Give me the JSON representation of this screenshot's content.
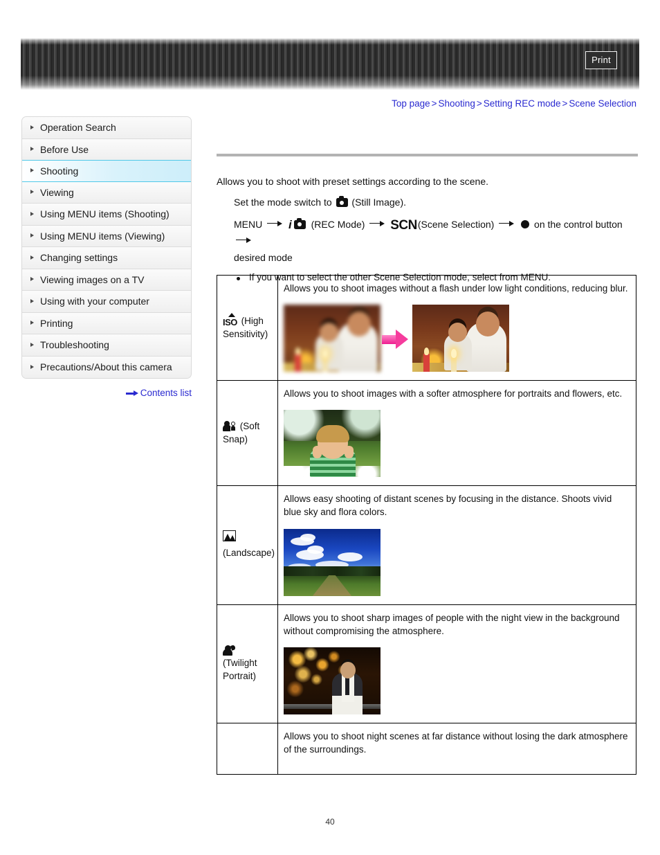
{
  "header": {
    "print_label": "Print"
  },
  "breadcrumb": {
    "items": [
      "Top page",
      "Shooting",
      "Setting REC mode",
      "Scene Selection"
    ],
    "separator": ">"
  },
  "sidebar": {
    "items": [
      {
        "label": "Operation Search",
        "active": false
      },
      {
        "label": "Before Use",
        "active": false
      },
      {
        "label": "Shooting",
        "active": true
      },
      {
        "label": "Viewing",
        "active": false
      },
      {
        "label": "Using MENU items (Shooting)",
        "active": false
      },
      {
        "label": "Using MENU items (Viewing)",
        "active": false
      },
      {
        "label": "Changing settings",
        "active": false
      },
      {
        "label": "Viewing images on a TV",
        "active": false
      },
      {
        "label": "Using with your computer",
        "active": false
      },
      {
        "label": "Printing",
        "active": false
      },
      {
        "label": "Troubleshooting",
        "active": false
      },
      {
        "label": "Precautions/About this camera",
        "active": false
      }
    ],
    "contents_link": "Contents list"
  },
  "main": {
    "intro": "Allows you to shoot with preset settings according to the scene.",
    "step1_pre": "Set the mode switch to",
    "step1_post": "(Still Image).",
    "step2_menu": "MENU",
    "step2_rec": "(REC Mode)",
    "step2_scn_glyph": "SCN",
    "step2_scn": "(Scene Selection)",
    "step2_control": "on the control button",
    "step2_desired": "desired mode",
    "bullet": "If you want to select the other Scene Selection mode, select from MENU."
  },
  "table": {
    "rows": [
      {
        "icon_name": "iso-high-sensitivity-icon",
        "icon_glyph": "ISO",
        "label": "(High Sensitivity)",
        "description": "Allows you to shoot images without a flash under low light conditions, reducing blur.",
        "images": [
          "dinner-blurred",
          "dinner-sharp"
        ],
        "has_arrow": true
      },
      {
        "icon_name": "soft-snap-icon",
        "icon_glyph": "",
        "label": "(Soft Snap)",
        "description": "Allows you to shoot images with a softer atmosphere for portraits and flowers, etc.",
        "images": [
          "boy-portrait"
        ],
        "has_arrow": false
      },
      {
        "icon_name": "landscape-icon",
        "icon_glyph": "",
        "label": "(Landscape)",
        "description": "Allows easy shooting of distant scenes by focusing in the distance. Shoots vivid blue sky and flora colors.",
        "images": [
          "landscape-field"
        ],
        "has_arrow": false
      },
      {
        "icon_name": "twilight-portrait-icon",
        "icon_glyph": "",
        "label": "(Twilight Portrait)",
        "description": "Allows you to shoot sharp images of people with the night view in the background without compromising the atmosphere.",
        "images": [
          "twilight-man"
        ],
        "has_arrow": false
      },
      {
        "icon_name": "twilight-icon",
        "icon_glyph": "",
        "label": "",
        "description": "Allows you to shoot night scenes at far distance without losing the dark atmosphere of the surroundings.",
        "images": [],
        "has_arrow": false
      }
    ]
  },
  "footer": {
    "page_number": "40"
  },
  "colors": {
    "link": "#2a2ad0",
    "active_sidebar": "#cdeefa",
    "arrow_pink": "#f53c9d",
    "banner_dark": "#3a3a3a"
  }
}
